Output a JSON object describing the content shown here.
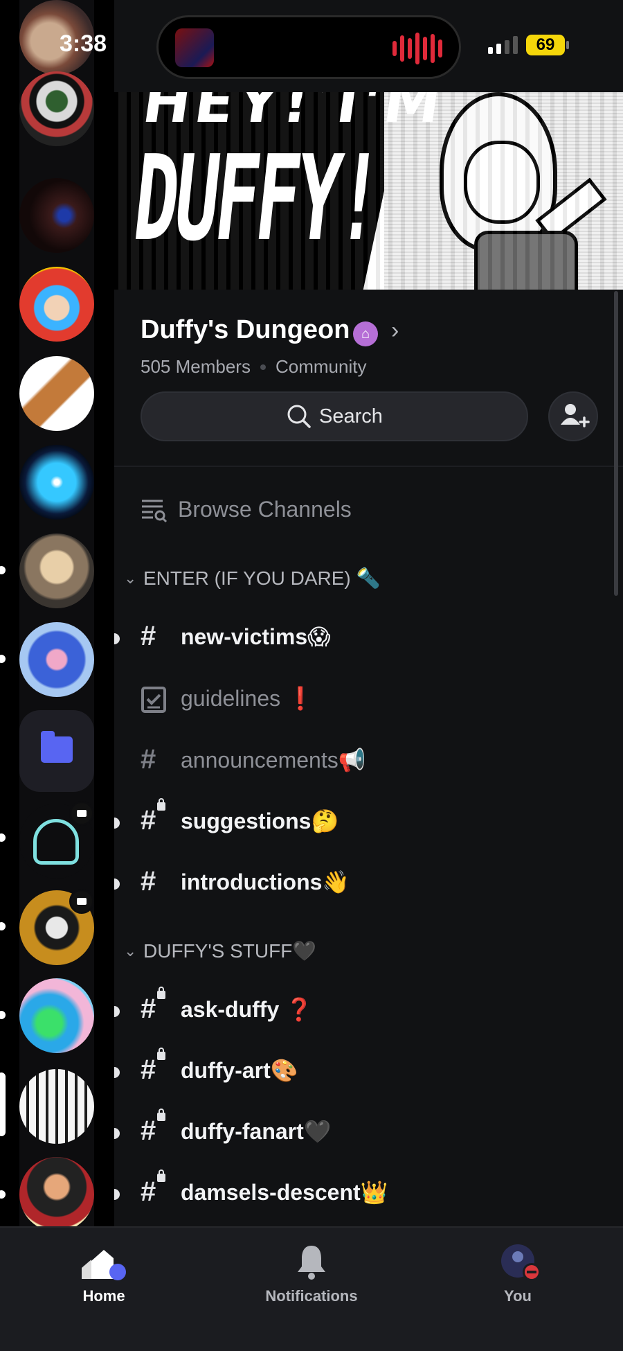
{
  "status_bar": {
    "time": "3:38",
    "battery": "69"
  },
  "guild": {
    "name": "Duffy's Dungeon",
    "members": "505 Members",
    "type": "Community"
  },
  "search": {
    "label": "Search"
  },
  "browse_channels": "Browse Channels",
  "categories": [
    {
      "label": "ENTER (IF YOU DARE) 🔦"
    },
    {
      "label": "DUFFY'S STUFF🖤"
    }
  ],
  "channels": [
    {
      "name": "new-victims😱"
    },
    {
      "name": "guidelines ❗"
    },
    {
      "name": "announcements📢"
    },
    {
      "name": "suggestions🤔"
    },
    {
      "name": "introductions👋"
    },
    {
      "name": "ask-duffy ❓"
    },
    {
      "name": "duffy-art🎨"
    },
    {
      "name": "duffy-fanart🖤"
    },
    {
      "name": "damsels-descent👑"
    }
  ],
  "tabs": [
    {
      "label": "Home"
    },
    {
      "label": "Notifications"
    },
    {
      "label": "You"
    }
  ],
  "colors": {
    "accent": "#5865f2",
    "background": "#111214",
    "boost_badge": "#b66fd6",
    "dnd": "#da373c"
  }
}
